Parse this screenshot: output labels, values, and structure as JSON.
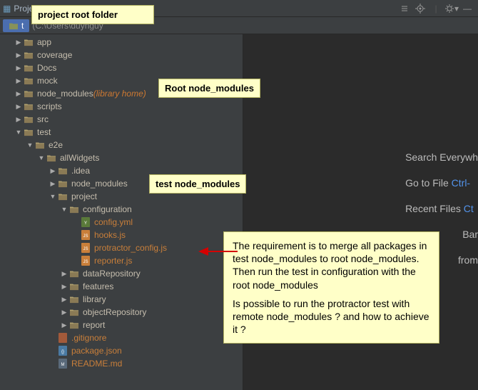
{
  "tab": {
    "title": "Project"
  },
  "bc": {
    "root": "t",
    "path": "(C:\\Users\\duynguy"
  },
  "actions": [
    "collapse",
    "target",
    "divider",
    "gear",
    "hide"
  ],
  "tree": [
    {
      "ind": 1,
      "arrow": "▶",
      "type": "folder",
      "label": "app",
      "orange": false
    },
    {
      "ind": 1,
      "arrow": "▶",
      "type": "folder",
      "label": "coverage",
      "orange": false
    },
    {
      "ind": 1,
      "arrow": "▶",
      "type": "folder",
      "label": "Docs",
      "orange": false
    },
    {
      "ind": 1,
      "arrow": "▶",
      "type": "folder",
      "label": "mock",
      "orange": false
    },
    {
      "ind": 1,
      "arrow": "▶",
      "type": "folder",
      "label": "node_modules",
      "lib": "(library home)",
      "orange": false
    },
    {
      "ind": 1,
      "arrow": "▶",
      "type": "folder",
      "label": "scripts",
      "orange": false
    },
    {
      "ind": 1,
      "arrow": "▶",
      "type": "folder",
      "label": "src",
      "orange": false
    },
    {
      "ind": 1,
      "arrow": "▼",
      "type": "folder",
      "label": "test",
      "orange": false
    },
    {
      "ind": 2,
      "arrow": "▼",
      "type": "folder",
      "label": "e2e",
      "orange": false
    },
    {
      "ind": 3,
      "arrow": "▼",
      "type": "folder",
      "label": "allWidgets",
      "orange": false
    },
    {
      "ind": 4,
      "arrow": "▶",
      "type": "folder",
      "label": ".idea",
      "orange": false
    },
    {
      "ind": 4,
      "arrow": "▶",
      "type": "folder",
      "label": "node_modules",
      "orange": false
    },
    {
      "ind": 4,
      "arrow": "▼",
      "type": "folder",
      "label": "project",
      "orange": false
    },
    {
      "ind": 5,
      "arrow": "▼",
      "type": "folder",
      "label": "configuration",
      "orange": false
    },
    {
      "ind": 6,
      "arrow": "",
      "type": "file-yml",
      "label": "config.yml",
      "orange": true
    },
    {
      "ind": 6,
      "arrow": "",
      "type": "file-js",
      "label": "hooks.js",
      "orange": true
    },
    {
      "ind": 6,
      "arrow": "",
      "type": "file-js",
      "label": "protractor_config.js",
      "orange": true
    },
    {
      "ind": 6,
      "arrow": "",
      "type": "file-js",
      "label": "reporter.js",
      "orange": true
    },
    {
      "ind": 5,
      "arrow": "▶",
      "type": "folder",
      "label": "dataRepository",
      "orange": false
    },
    {
      "ind": 5,
      "arrow": "▶",
      "type": "folder",
      "label": "features",
      "orange": false
    },
    {
      "ind": 5,
      "arrow": "▶",
      "type": "folder",
      "label": "library",
      "orange": false
    },
    {
      "ind": 5,
      "arrow": "▶",
      "type": "folder",
      "label": "objectRepository",
      "orange": false
    },
    {
      "ind": 5,
      "arrow": "▶",
      "type": "folder",
      "label": "report",
      "orange": false
    },
    {
      "ind": 4,
      "arrow": "",
      "type": "file-git",
      "label": ".gitignore",
      "orange": true
    },
    {
      "ind": 4,
      "arrow": "",
      "type": "file-json",
      "label": "package.json",
      "orange": true
    },
    {
      "ind": 4,
      "arrow": "",
      "type": "file-md",
      "label": "README.md",
      "orange": true
    }
  ],
  "right": {
    "search": "Search Everywh",
    "goto": "Go to File",
    "goto_key": "Ctrl-",
    "recent": "Recent Files",
    "recent_key": "Ct",
    "bar": "Bar",
    "from": "from"
  },
  "callouts": {
    "c1": "project root folder",
    "c2": "Root node_modules",
    "c3": "test node_modules",
    "big": "The requirement is to merge all packages in test node_modules to root node_modules.\nThen run the test in configuration with the root node_modules\n\nIs possible to run the protractor test with remote node_modules ? and how to achieve it ?"
  }
}
